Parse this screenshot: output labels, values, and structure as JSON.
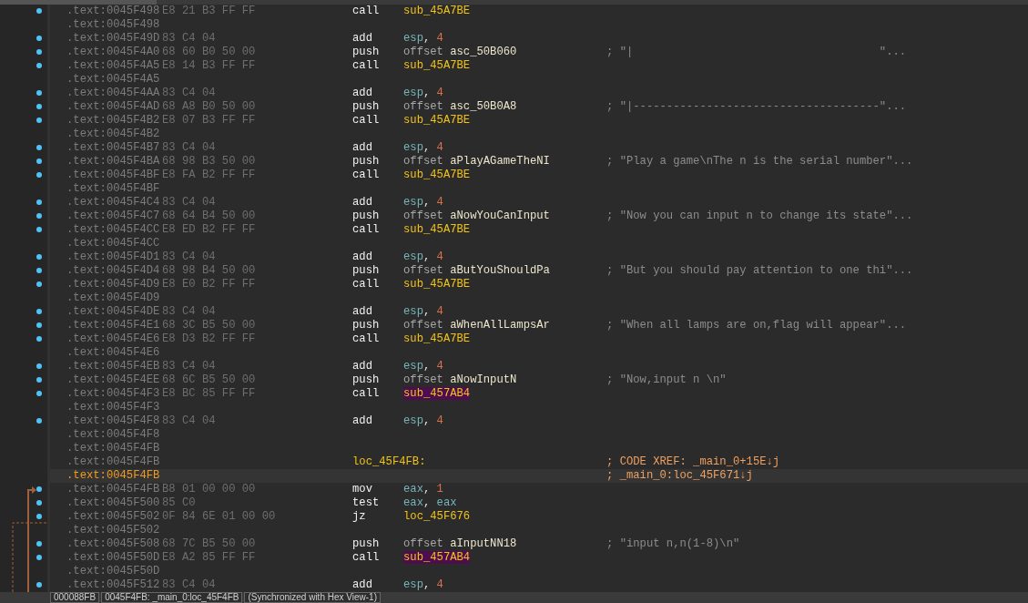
{
  "listing": {
    "rows": [
      {
        "address": ".text:0045F498",
        "bytes": "E8 21 B3 FF FF",
        "mnemonic": "call",
        "operands": [
          {
            "text": "sub_45A7BE",
            "kind": "proc"
          }
        ],
        "dot": true,
        "current": false
      },
      {
        "address": ".text:0045F498",
        "dot": false,
        "current": false
      },
      {
        "address": ".text:0045F49D",
        "bytes": "83 C4 04",
        "mnemonic": "add",
        "operands": [
          {
            "text": "esp",
            "kind": "reg"
          },
          {
            "text": ", ",
            "kind": "punct"
          },
          {
            "text": "4",
            "kind": "num"
          }
        ],
        "dot": true,
        "current": false
      },
      {
        "address": ".text:0045F4A0",
        "bytes": "68 60 B0 50 00",
        "mnemonic": "push",
        "operands": [
          {
            "text": "offset ",
            "kind": "kw"
          },
          {
            "text": "asc_50B060",
            "kind": "name"
          }
        ],
        "comment": {
          "text": "; \"|                                     \"...",
          "kind": "string"
        },
        "dot": true,
        "current": false
      },
      {
        "address": ".text:0045F4A5",
        "bytes": "E8 14 B3 FF FF",
        "mnemonic": "call",
        "operands": [
          {
            "text": "sub_45A7BE",
            "kind": "proc"
          }
        ],
        "dot": true,
        "current": false
      },
      {
        "address": ".text:0045F4A5",
        "dot": false,
        "current": false
      },
      {
        "address": ".text:0045F4AA",
        "bytes": "83 C4 04",
        "mnemonic": "add",
        "operands": [
          {
            "text": "esp",
            "kind": "reg"
          },
          {
            "text": ", ",
            "kind": "punct"
          },
          {
            "text": "4",
            "kind": "num"
          }
        ],
        "dot": true,
        "current": false
      },
      {
        "address": ".text:0045F4AD",
        "bytes": "68 A8 B0 50 00",
        "mnemonic": "push",
        "operands": [
          {
            "text": "offset ",
            "kind": "kw"
          },
          {
            "text": "asc_50B0A8",
            "kind": "name"
          }
        ],
        "comment": {
          "text": "; \"|-------------------------------------\"...",
          "kind": "string"
        },
        "dot": true,
        "current": false
      },
      {
        "address": ".text:0045F4B2",
        "bytes": "E8 07 B3 FF FF",
        "mnemonic": "call",
        "operands": [
          {
            "text": "sub_45A7BE",
            "kind": "proc"
          }
        ],
        "dot": true,
        "current": false
      },
      {
        "address": ".text:0045F4B2",
        "dot": false,
        "current": false
      },
      {
        "address": ".text:0045F4B7",
        "bytes": "83 C4 04",
        "mnemonic": "add",
        "operands": [
          {
            "text": "esp",
            "kind": "reg"
          },
          {
            "text": ", ",
            "kind": "punct"
          },
          {
            "text": "4",
            "kind": "num"
          }
        ],
        "dot": true,
        "current": false
      },
      {
        "address": ".text:0045F4BA",
        "bytes": "68 98 B3 50 00",
        "mnemonic": "push",
        "operands": [
          {
            "text": "offset ",
            "kind": "kw"
          },
          {
            "text": "aPlayAGameTheNI",
            "kind": "name"
          }
        ],
        "comment": {
          "text": "; \"Play a game\\nThe n is the serial number\"...",
          "kind": "string"
        },
        "dot": true,
        "current": false
      },
      {
        "address": ".text:0045F4BF",
        "bytes": "E8 FA B2 FF FF",
        "mnemonic": "call",
        "operands": [
          {
            "text": "sub_45A7BE",
            "kind": "proc"
          }
        ],
        "dot": true,
        "current": false
      },
      {
        "address": ".text:0045F4BF",
        "dot": false,
        "current": false
      },
      {
        "address": ".text:0045F4C4",
        "bytes": "83 C4 04",
        "mnemonic": "add",
        "operands": [
          {
            "text": "esp",
            "kind": "reg"
          },
          {
            "text": ", ",
            "kind": "punct"
          },
          {
            "text": "4",
            "kind": "num"
          }
        ],
        "dot": true,
        "current": false
      },
      {
        "address": ".text:0045F4C7",
        "bytes": "68 64 B4 50 00",
        "mnemonic": "push",
        "operands": [
          {
            "text": "offset ",
            "kind": "kw"
          },
          {
            "text": "aNowYouCanInput",
            "kind": "name"
          }
        ],
        "comment": {
          "text": "; \"Now you can input n to change its state\"...",
          "kind": "string"
        },
        "dot": true,
        "current": false
      },
      {
        "address": ".text:0045F4CC",
        "bytes": "E8 ED B2 FF FF",
        "mnemonic": "call",
        "operands": [
          {
            "text": "sub_45A7BE",
            "kind": "proc"
          }
        ],
        "dot": true,
        "current": false
      },
      {
        "address": ".text:0045F4CC",
        "dot": false,
        "current": false
      },
      {
        "address": ".text:0045F4D1",
        "bytes": "83 C4 04",
        "mnemonic": "add",
        "operands": [
          {
            "text": "esp",
            "kind": "reg"
          },
          {
            "text": ", ",
            "kind": "punct"
          },
          {
            "text": "4",
            "kind": "num"
          }
        ],
        "dot": true,
        "current": false
      },
      {
        "address": ".text:0045F4D4",
        "bytes": "68 98 B4 50 00",
        "mnemonic": "push",
        "operands": [
          {
            "text": "offset ",
            "kind": "kw"
          },
          {
            "text": "aButYouShouldPa",
            "kind": "name"
          }
        ],
        "comment": {
          "text": "; \"But you should pay attention to one thi\"...",
          "kind": "string"
        },
        "dot": true,
        "current": false
      },
      {
        "address": ".text:0045F4D9",
        "bytes": "E8 E0 B2 FF FF",
        "mnemonic": "call",
        "operands": [
          {
            "text": "sub_45A7BE",
            "kind": "proc"
          }
        ],
        "dot": true,
        "current": false
      },
      {
        "address": ".text:0045F4D9",
        "dot": false,
        "current": false
      },
      {
        "address": ".text:0045F4DE",
        "bytes": "83 C4 04",
        "mnemonic": "add",
        "operands": [
          {
            "text": "esp",
            "kind": "reg"
          },
          {
            "text": ", ",
            "kind": "punct"
          },
          {
            "text": "4",
            "kind": "num"
          }
        ],
        "dot": true,
        "current": false
      },
      {
        "address": ".text:0045F4E1",
        "bytes": "68 3C B5 50 00",
        "mnemonic": "push",
        "operands": [
          {
            "text": "offset ",
            "kind": "kw"
          },
          {
            "text": "aWhenAllLampsAr",
            "kind": "name"
          }
        ],
        "comment": {
          "text": "; \"When all lamps are on,flag will appear\"...",
          "kind": "string"
        },
        "dot": true,
        "current": false
      },
      {
        "address": ".text:0045F4E6",
        "bytes": "E8 D3 B2 FF FF",
        "mnemonic": "call",
        "operands": [
          {
            "text": "sub_45A7BE",
            "kind": "proc"
          }
        ],
        "dot": true,
        "current": false
      },
      {
        "address": ".text:0045F4E6",
        "dot": false,
        "current": false
      },
      {
        "address": ".text:0045F4EB",
        "bytes": "83 C4 04",
        "mnemonic": "add",
        "operands": [
          {
            "text": "esp",
            "kind": "reg"
          },
          {
            "text": ", ",
            "kind": "punct"
          },
          {
            "text": "4",
            "kind": "num"
          }
        ],
        "dot": true,
        "current": false
      },
      {
        "address": ".text:0045F4EE",
        "bytes": "68 6C B5 50 00",
        "mnemonic": "push",
        "operands": [
          {
            "text": "offset ",
            "kind": "kw"
          },
          {
            "text": "aNowInputN",
            "kind": "name"
          }
        ],
        "comment": {
          "text": "; \"Now,input n \\n\"",
          "kind": "string"
        },
        "dot": true,
        "current": false
      },
      {
        "address": ".text:0045F4F3",
        "bytes": "E8 BC 85 FF FF",
        "mnemonic": "call",
        "operands": [
          {
            "text": "sub_457AB4",
            "kind": "import"
          }
        ],
        "dot": true,
        "current": false
      },
      {
        "address": ".text:0045F4F3",
        "dot": false,
        "current": false
      },
      {
        "address": ".text:0045F4F8",
        "bytes": "83 C4 04",
        "mnemonic": "add",
        "operands": [
          {
            "text": "esp",
            "kind": "reg"
          },
          {
            "text": ", ",
            "kind": "punct"
          },
          {
            "text": "4",
            "kind": "num"
          }
        ],
        "dot": true,
        "current": false
      },
      {
        "address": ".text:0045F4F8",
        "dot": false,
        "current": false
      },
      {
        "address": ".text:0045F4FB",
        "dot": false,
        "current": false
      },
      {
        "address": ".text:0045F4FB",
        "label": "loc_45F4FB:",
        "comment": {
          "text": "; CODE XREF: _main_0+15E↓j",
          "kind": "xref"
        },
        "dot": false,
        "current": false
      },
      {
        "address": ".text:0045F4FB",
        "comment": {
          "text": "; _main_0:loc_45F671↓j",
          "kind": "xref"
        },
        "dot": false,
        "current": true
      },
      {
        "address": ".text:0045F4FB",
        "bytes": "B8 01 00 00 00",
        "mnemonic": "mov",
        "operands": [
          {
            "text": "eax",
            "kind": "reg"
          },
          {
            "text": ", ",
            "kind": "punct"
          },
          {
            "text": "1",
            "kind": "num"
          }
        ],
        "dot": true,
        "current": false
      },
      {
        "address": ".text:0045F500",
        "bytes": "85 C0",
        "mnemonic": "test",
        "operands": [
          {
            "text": "eax",
            "kind": "reg"
          },
          {
            "text": ", ",
            "kind": "punct"
          },
          {
            "text": "eax",
            "kind": "reg"
          }
        ],
        "dot": true,
        "current": false
      },
      {
        "address": ".text:0045F502",
        "bytes": "0F 84 6E 01 00 00",
        "mnemonic": "jz",
        "operands": [
          {
            "text": "loc_45F676",
            "kind": "proc"
          }
        ],
        "dot": true,
        "current": false
      },
      {
        "address": ".text:0045F502",
        "dot": false,
        "current": false
      },
      {
        "address": ".text:0045F508",
        "bytes": "68 7C B5 50 00",
        "mnemonic": "push",
        "operands": [
          {
            "text": "offset ",
            "kind": "kw"
          },
          {
            "text": "aInputNN18",
            "kind": "name"
          }
        ],
        "comment": {
          "text": "; \"input n,n(1-8)\\n\"",
          "kind": "string"
        },
        "dot": true,
        "current": false
      },
      {
        "address": ".text:0045F50D",
        "bytes": "E8 A2 85 FF FF",
        "mnemonic": "call",
        "operands": [
          {
            "text": "sub_457AB4",
            "kind": "import"
          }
        ],
        "dot": true,
        "current": false
      },
      {
        "address": ".text:0045F50D",
        "dot": false,
        "current": false
      },
      {
        "address": ".text:0045F512",
        "bytes": "83 C4 04",
        "mnemonic": "add",
        "operands": [
          {
            "text": "esp",
            "kind": "reg"
          },
          {
            "text": ", ",
            "kind": "punct"
          },
          {
            "text": "4",
            "kind": "num"
          }
        ],
        "dot": true,
        "current": false
      }
    ]
  },
  "status_bar": {
    "fields": [
      "000088FB",
      "0045F4FB: _main_0:loc_45F4FB",
      "(Synchronized with Hex View-1)"
    ]
  }
}
